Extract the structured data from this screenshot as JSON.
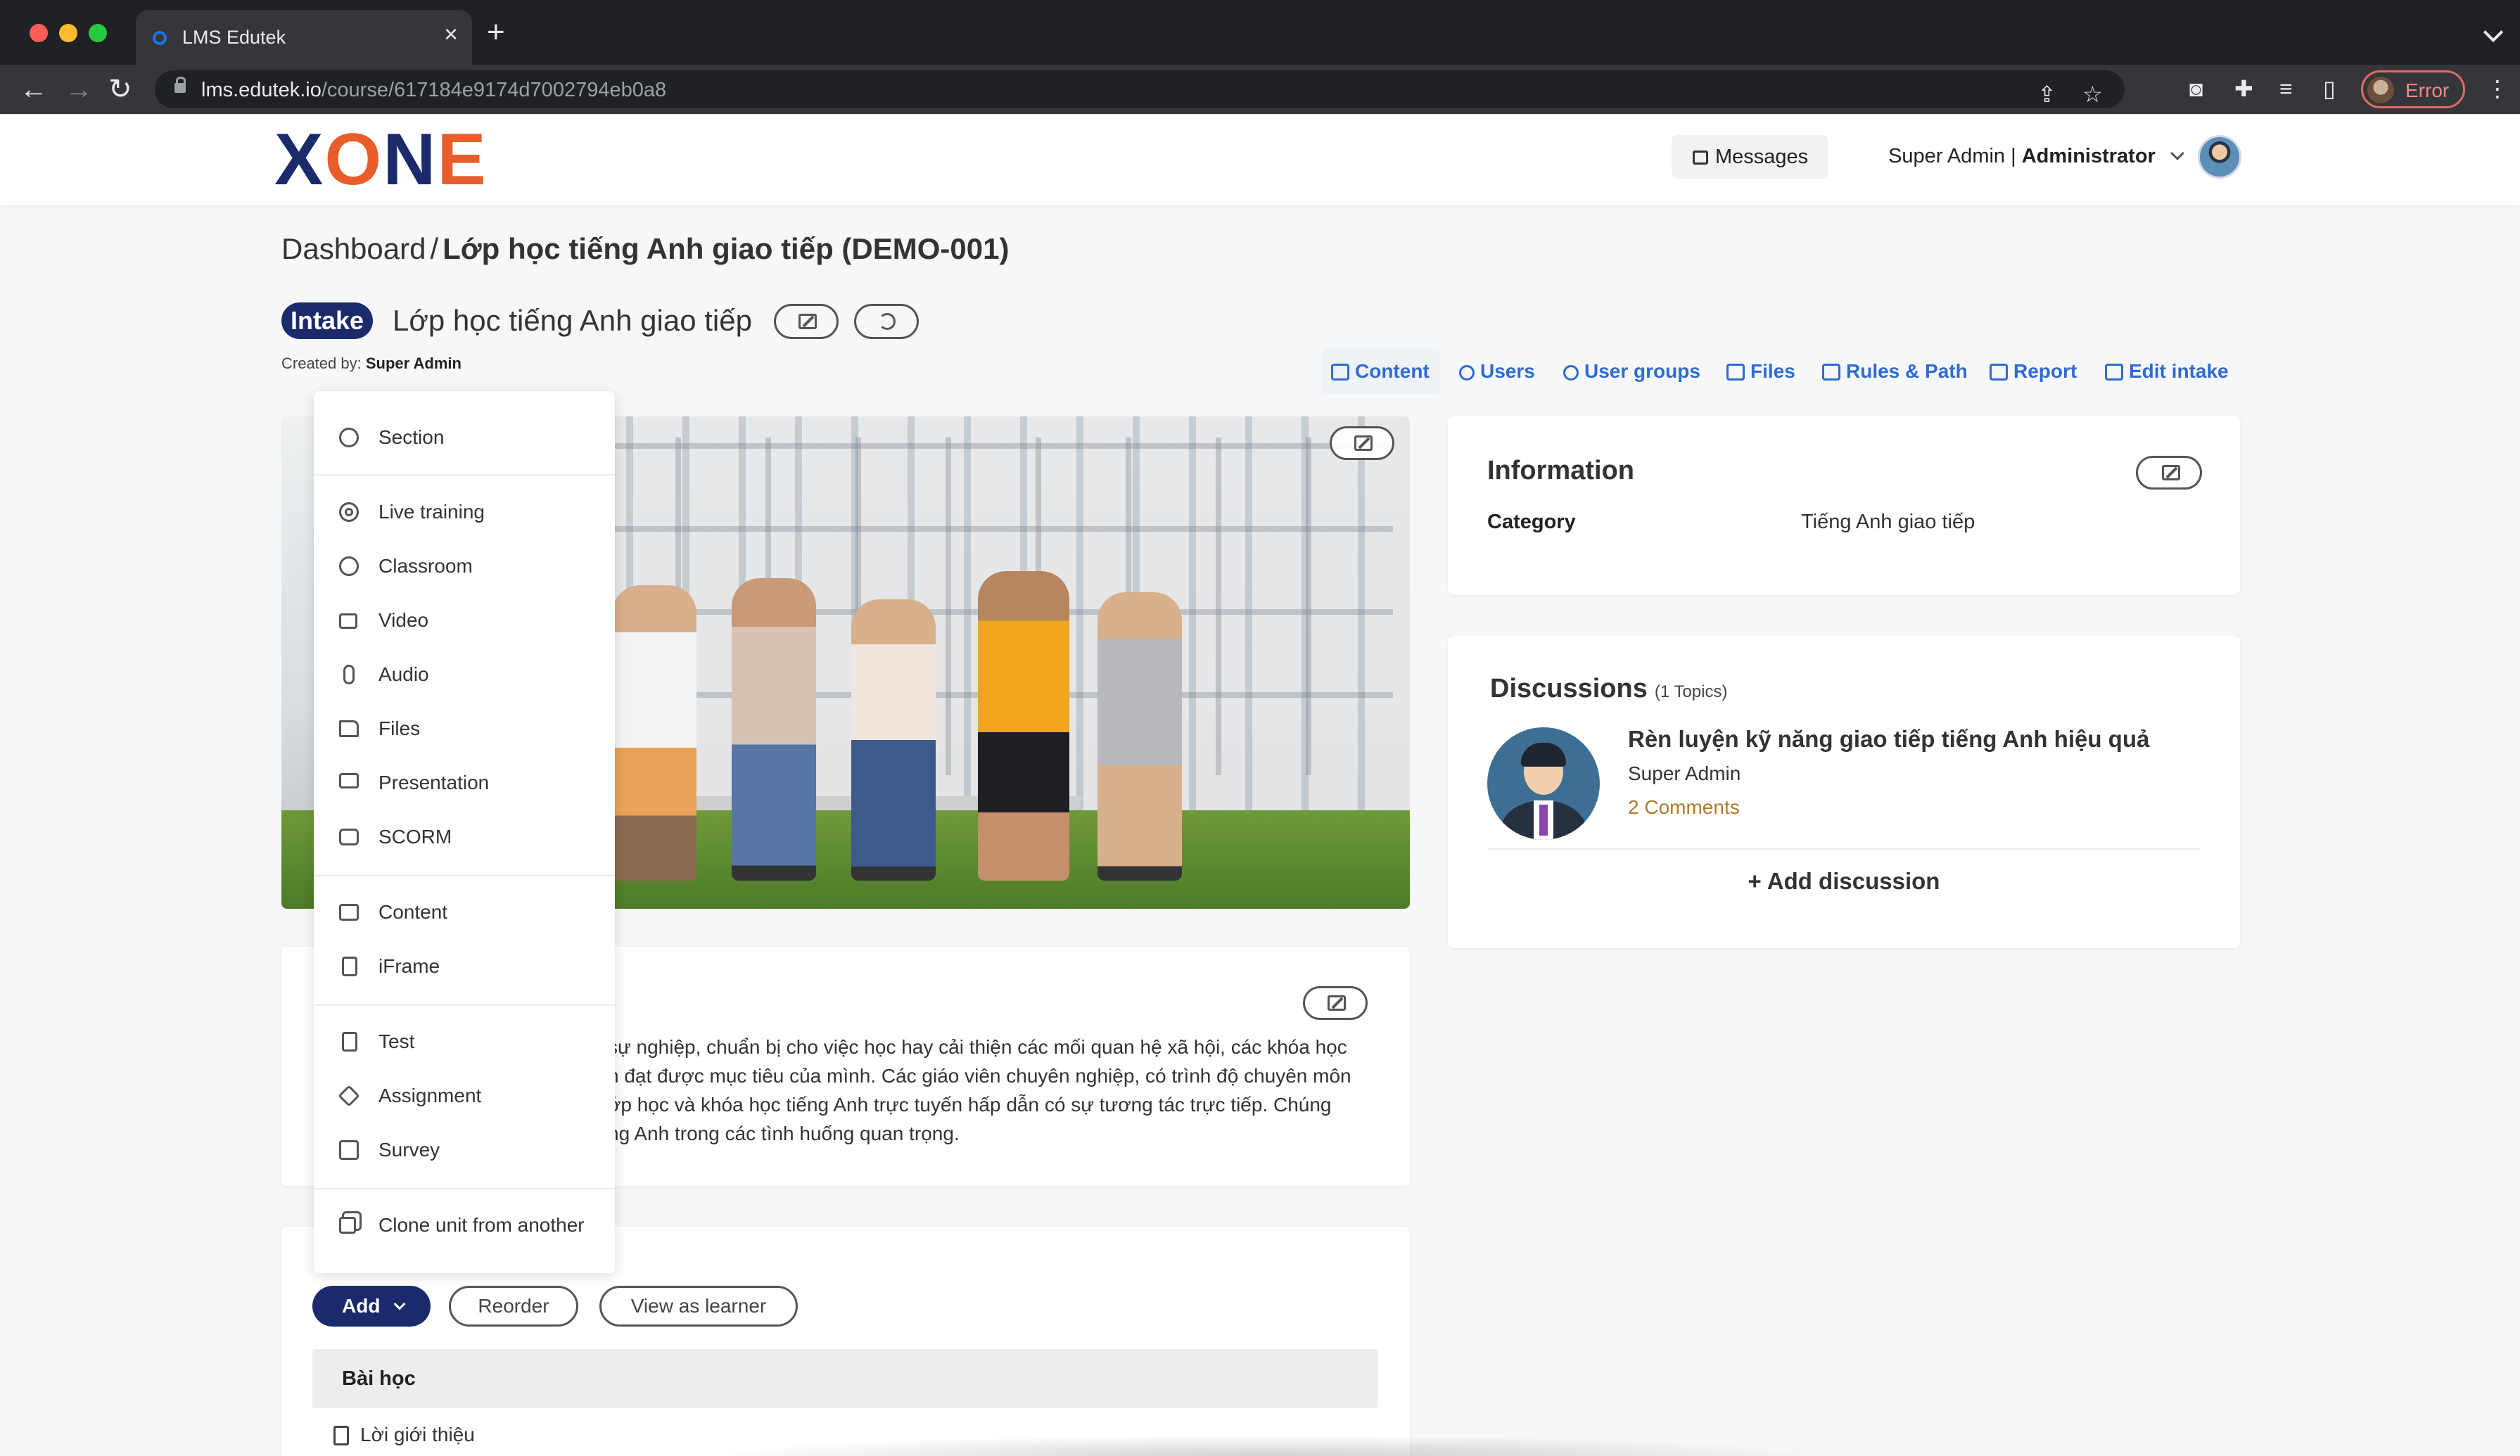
{
  "browser": {
    "tab_title": "LMS Edutek",
    "tab_close": "×",
    "new_tab": "+",
    "url_host": "lms.edutek.io",
    "url_path": "/course/617184e9174d7002794eb0a8",
    "profile_status": "Error",
    "colors": {
      "close": "#ff5f57",
      "minimize": "#febc2e",
      "maximize": "#28c840"
    }
  },
  "header": {
    "logo": {
      "x": "X",
      "o": "O",
      "n": "N",
      "e": "E"
    },
    "messages_label": "Messages",
    "user_name": "Super Admin",
    "user_separator": " | ",
    "user_role": "Administrator"
  },
  "page": {
    "breadcrumb_root": "Dashboard",
    "breadcrumb_separator": "/",
    "breadcrumb_current": "Lớp học tiếng Anh giao tiếp (DEMO-001)",
    "badge": "Intake",
    "course_title": "Lớp học tiếng Anh giao tiếp",
    "created_by_label": "Created by:",
    "created_by_name": "Super Admin"
  },
  "tabs": [
    {
      "label": "Content",
      "icon": "layers-icon",
      "active": true
    },
    {
      "label": "Users",
      "icon": "user-icon"
    },
    {
      "label": "User groups",
      "icon": "users-icon"
    },
    {
      "label": "Files",
      "icon": "folder-icon"
    },
    {
      "label": "Rules & Path",
      "icon": "map-icon"
    },
    {
      "label": "Report",
      "icon": "trend-icon"
    },
    {
      "label": "Edit intake",
      "icon": "edit-icon"
    }
  ],
  "description": {
    "lines": [
      "sự nghiệp, chuẩn bị cho việc học hay cải thiện các mối quan hệ xã hội, các khóa học",
      "n đạt được mục tiêu của mình. Các giáo viên chuyên nghiệp, có trình độ chuyên môn",
      "ớp học và khóa học tiếng Anh trực tuyến hấp dẫn có sự tương tác trực tiếp. Chúng",
      "ng Anh trong các tình huống quan trọng."
    ]
  },
  "units": {
    "add_label": "Add",
    "reorder_label": "Reorder",
    "view_as_learner_label": "View as learner",
    "lesson_group": "Bài học",
    "lesson_item": "Lời giới thiệu"
  },
  "dropdown": {
    "items": [
      {
        "label": "Section",
        "icon": "compass-icon"
      },
      {
        "label": "Live training",
        "icon": "target-icon"
      },
      {
        "label": "Classroom",
        "icon": "clock-icon"
      },
      {
        "label": "Video",
        "icon": "video-icon"
      },
      {
        "label": "Audio",
        "icon": "microphone-icon"
      },
      {
        "label": "Files",
        "icon": "folder-icon"
      },
      {
        "label": "Presentation",
        "icon": "monitor-icon"
      },
      {
        "label": "SCORM",
        "icon": "inbox-icon"
      },
      {
        "label": "Content",
        "icon": "book-icon"
      },
      {
        "label": "iFrame",
        "icon": "document-icon"
      },
      {
        "label": "Test",
        "icon": "file-icon"
      },
      {
        "label": "Assignment",
        "icon": "pen-tool-icon"
      },
      {
        "label": "Survey",
        "icon": "checkbox-icon"
      },
      {
        "label": "Clone unit from another",
        "icon": "copy-icon"
      }
    ]
  },
  "information": {
    "title": "Information",
    "category_label": "Category",
    "category_value": "Tiếng Anh giao tiếp"
  },
  "discussions": {
    "title": "Discussions",
    "count": "(1 Topics)",
    "topic_title": "Rèn luyện kỹ năng giao tiếp tiếng Anh hiệu quả",
    "topic_author": "Super Admin",
    "topic_comments": "2 Comments",
    "add_label": "+ Add discussion"
  }
}
